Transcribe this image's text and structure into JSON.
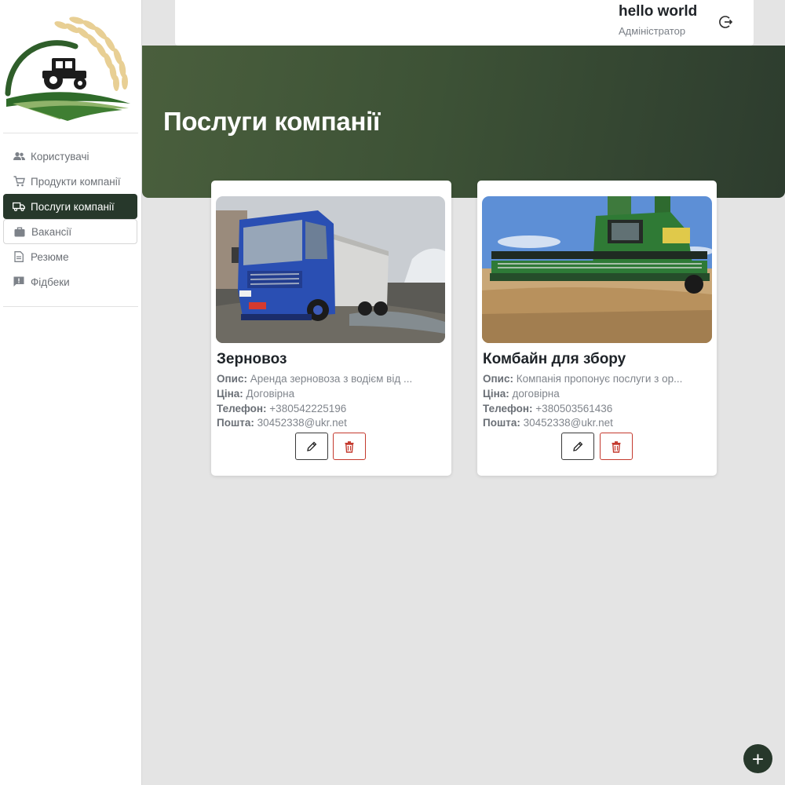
{
  "sidebar": {
    "logo_icon": "tractor-wheat-logo",
    "items": [
      {
        "label": "Користувачі",
        "icon": "users-icon"
      },
      {
        "label": "Продукти компанії",
        "icon": "cart-icon"
      },
      {
        "label": "Послуги компанії",
        "icon": "truck-icon",
        "active": true
      },
      {
        "label": "Вакансії",
        "icon": "briefcase-icon"
      },
      {
        "label": "Резюме",
        "icon": "document-icon"
      },
      {
        "label": "Фідбеки",
        "icon": "feedback-icon"
      }
    ]
  },
  "header": {
    "user_name": "hello world",
    "user_role": "Адміністратор",
    "logout_icon": "logout-icon"
  },
  "page": {
    "title": "Послуги компанії"
  },
  "labels": {
    "description": "Опис:",
    "price": "Ціна:",
    "phone": "Телефон:",
    "email": "Пошта:"
  },
  "services": [
    {
      "title": "Зерновоз",
      "description": "Аренда зерновоза з водієм від ...",
      "price": "Договірна",
      "phone": "+380542225196",
      "email": "30452338@ukr.net",
      "image": "grain-truck-photo"
    },
    {
      "title": "Комбайн для збору",
      "description": "Компанія пропонує послуги з ор...",
      "price": "договірна",
      "phone": "+380503561436",
      "email": "30452338@ukr.net",
      "image": "combine-harvester-photo"
    }
  ],
  "fab": {
    "label": "+",
    "icon": "plus-icon"
  },
  "colors": {
    "accent_dark": "#27382b",
    "banner": "#3d5236",
    "delete": "#c43a2e"
  }
}
